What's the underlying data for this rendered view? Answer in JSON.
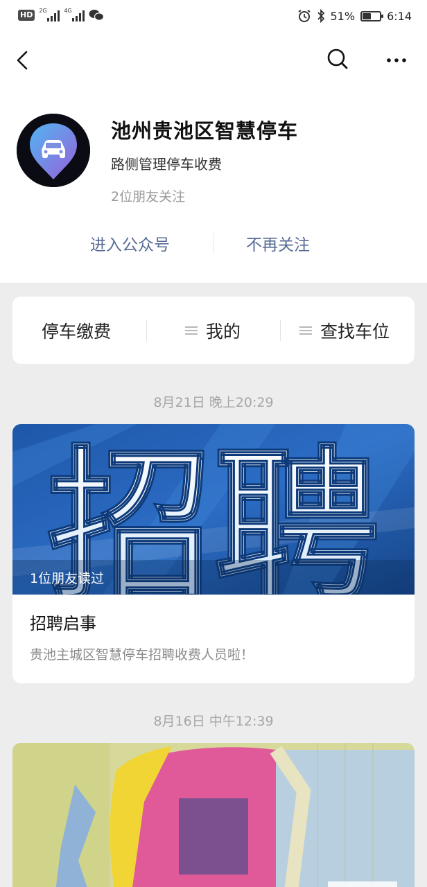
{
  "status_bar": {
    "hd": "HD",
    "net1": "2G",
    "net2": "4G",
    "battery_pct": "51%",
    "battery_level": 0.51,
    "time": "6:14",
    "icons": [
      "wechat-icon",
      "alarm-icon",
      "bluetooth-icon"
    ]
  },
  "nav": {
    "back_icon": "chevron-left-icon",
    "search_icon": "search-icon",
    "more_icon": "more-icon"
  },
  "profile": {
    "name": "池州贵池区智慧停车",
    "description": "路侧管理停车收费",
    "friends": "2位朋友关注",
    "enter_label": "进入公众号",
    "unfollow_label": "不再关注",
    "link_color": "#576b95"
  },
  "menu": {
    "items": [
      {
        "label": "停车缴费"
      },
      {
        "label": "我的"
      },
      {
        "label": "查找车位"
      }
    ]
  },
  "feed": [
    {
      "date": "8月21日 晚上20:29",
      "cover_text": "招聘",
      "read_count": "1位朋友读过",
      "title": "招聘启事",
      "summary": "贵池主城区智慧停车招聘收费人员啦！"
    },
    {
      "date": "8月16日 中午12:39"
    }
  ]
}
